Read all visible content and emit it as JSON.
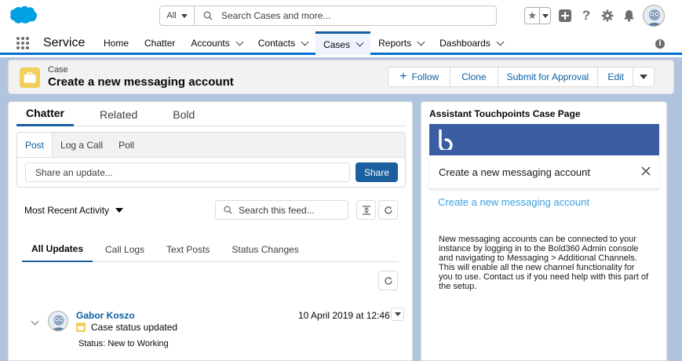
{
  "header": {
    "search_scope": "All",
    "search_placeholder": "Search Cases and more..."
  },
  "nav": {
    "app_name": "Service",
    "items": [
      {
        "label": "Home",
        "has_menu": false
      },
      {
        "label": "Chatter",
        "has_menu": false
      },
      {
        "label": "Accounts",
        "has_menu": true
      },
      {
        "label": "Contacts",
        "has_menu": true
      },
      {
        "label": "Cases",
        "has_menu": true,
        "active": true
      },
      {
        "label": "Reports",
        "has_menu": true
      },
      {
        "label": "Dashboards",
        "has_menu": true
      }
    ]
  },
  "record": {
    "object_label": "Case",
    "title": "Create a new messaging account",
    "actions": {
      "follow": "Follow",
      "clone": "Clone",
      "submit": "Submit for Approval",
      "edit": "Edit"
    }
  },
  "tabs": [
    "Chatter",
    "Related",
    "Bold"
  ],
  "publisher": {
    "tabs": [
      "Post",
      "Log a Call",
      "Poll"
    ],
    "input_placeholder": "Share an update...",
    "share_label": "Share"
  },
  "feed": {
    "sort_label": "Most Recent Activity",
    "search_placeholder": "Search this feed...",
    "tabs": [
      "All Updates",
      "Call Logs",
      "Text Posts",
      "Status Changes"
    ],
    "items": [
      {
        "author": "Gabor Koszo",
        "event": "Case status updated",
        "date": "10 April 2019 at 12:46",
        "status_label": "Status:",
        "status_change": "New to Working"
      }
    ]
  },
  "sidebar": {
    "title": "Assistant Touchpoints Case Page",
    "touchpoint_title": "Create a new messaging account",
    "link_text": "Create a new messaging account",
    "body": "New messaging accounts can be connected to your instance by logging in to the Bold360 Admin console and navigating to Messaging > Additional Channels. This will enable all the new channel functionality for you to use. Contact us if you need help with this part of the setup."
  },
  "colors": {
    "brand_blue": "#1b5f9e",
    "nav_accent": "#0070d2",
    "case_yellow": "#f2cf5b",
    "bold_bar": "#3b5ea3",
    "link_blue": "#3ba0e0",
    "page_bg": "#b0c4df"
  },
  "icons": [
    "salesforce-cloud-icon",
    "search-icon",
    "star-icon",
    "plus-icon",
    "help-icon",
    "gear-icon",
    "bell-icon",
    "app-launcher-icon",
    "info-icon",
    "case-icon",
    "refresh-icon",
    "collapse-icon",
    "close-icon",
    "bold-logo-icon"
  ]
}
